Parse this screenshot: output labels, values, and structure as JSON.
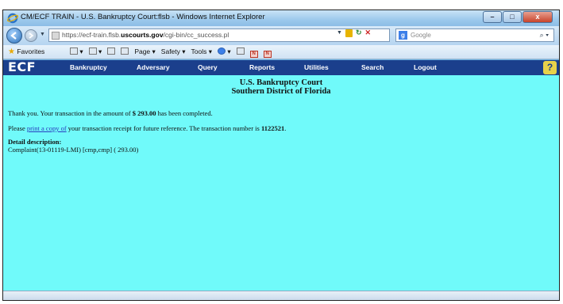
{
  "window": {
    "title": "CM/ECF TRAIN - U.S. Bankruptcy Court:flsb - Windows Internet Explorer",
    "controls": {
      "minimize": "–",
      "maximize": "□",
      "close": "x"
    }
  },
  "address_bar": {
    "url_prefix": "https://ecf-train.flsb.",
    "url_domain": "uscourts.gov",
    "url_path": "/cgi-bin/cc_success.pl",
    "search_placeholder": "Google",
    "search_engine_glyph": "g"
  },
  "command_bar": {
    "favorites": "Favorites",
    "items": [
      "▾",
      "▾",
      "Page ▾",
      "Safety ▾",
      "Tools ▾",
      "▾"
    ]
  },
  "ecf_menu": {
    "logo": "ECF",
    "items": [
      "Bankruptcy",
      "Adversary",
      "Query",
      "Reports",
      "Utilities",
      "Search",
      "Logout"
    ],
    "help": "?"
  },
  "content": {
    "court_line1": "U.S. Bankruptcy Court",
    "court_line2": "Southern District of Florida",
    "thank_you_prefix": "Thank you. Your transaction in the amount of ",
    "amount": "$ 293.00",
    "thank_you_suffix": " has been completed.",
    "receipt_prefix": "Please ",
    "receipt_link": "print a copy of",
    "receipt_middle": " your transaction receipt for future reference. The transaction number is ",
    "transaction_number": "1122521",
    "receipt_end": ".",
    "detail_heading": "Detail description:",
    "detail_line": "Complaint(13-01119-LMI) [cmp,cmp] ( 293.00)"
  },
  "colors": {
    "content_bg": "#70fafa",
    "menu_bg": "#1b3f8c",
    "link": "#2a3fbf"
  }
}
